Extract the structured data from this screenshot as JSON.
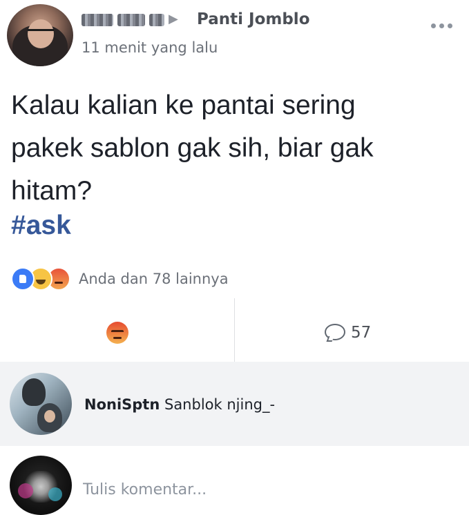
{
  "post": {
    "author_name_redacted": true,
    "group_name": "Panti Jomblo",
    "timestamp": "11 menit yang lalu",
    "text_lines": [
      "Kalau kalian ke pantai sering",
      "pakek sablon gak sih, biar gak",
      "hitam?"
    ],
    "hashtag": "#ask"
  },
  "reactions": {
    "types": [
      "like",
      "haha",
      "angry"
    ],
    "summary": "Anda dan 78 lainnya"
  },
  "actions": {
    "selected_reaction": "angry",
    "comment_count": "57"
  },
  "comments": [
    {
      "author": "NoniSptn",
      "text": "Sanblok njing_-"
    }
  ],
  "composer": {
    "placeholder": "Tulis komentar..."
  },
  "colors": {
    "hashtag": "#365899",
    "comment_bg": "#f2f3f5",
    "muted_text": "#6b7078",
    "like_blue": "#3b7bf6"
  }
}
